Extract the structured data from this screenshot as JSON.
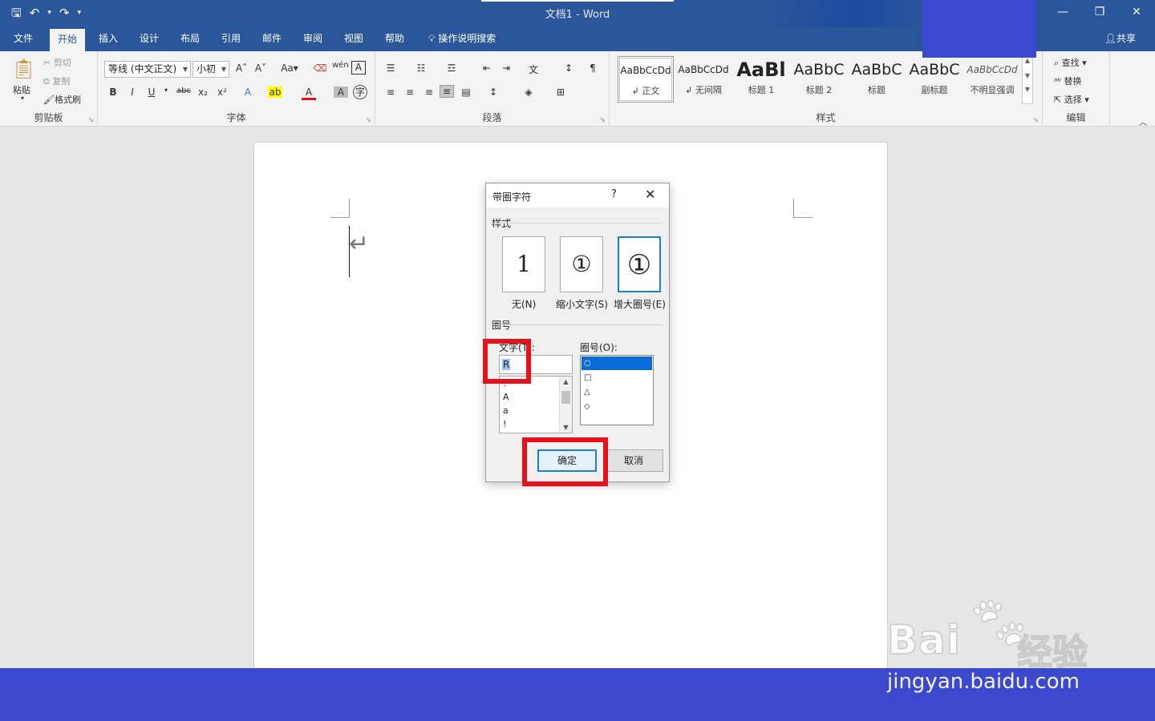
{
  "app": {
    "title": "文档1  -  Word"
  },
  "qat": {
    "save_icon": "save-icon",
    "undo_icon": "undo-icon",
    "redo_icon": "redo-icon",
    "customize_icon": "customize-qat-icon"
  },
  "window_controls": {
    "minimize": "—",
    "restore": "❐",
    "close": "✕"
  },
  "tabs": [
    {
      "label": "文件"
    },
    {
      "label": "开始"
    },
    {
      "label": "插入"
    },
    {
      "label": "设计"
    },
    {
      "label": "布局"
    },
    {
      "label": "引用"
    },
    {
      "label": "邮件"
    },
    {
      "label": "审阅"
    },
    {
      "label": "视图"
    },
    {
      "label": "帮助"
    }
  ],
  "tellme": {
    "label": "操作说明搜索"
  },
  "share": {
    "label": "共享"
  },
  "ribbon": {
    "clipboard": {
      "label": "剪贴板",
      "paste": "粘贴",
      "cut": "剪切",
      "copy": "复制",
      "format_painter": "格式刷"
    },
    "font": {
      "label": "字体",
      "font_name": "等线 (中文正文)",
      "font_size": "小初"
    },
    "paragraph": {
      "label": "段落"
    },
    "styles": {
      "label": "样式",
      "items": [
        {
          "preview": "AaBbCcDd",
          "name": "↲ 正文"
        },
        {
          "preview": "AaBbCcDd",
          "name": "↲ 无间隔"
        },
        {
          "preview": "AaBl",
          "name": "标题 1"
        },
        {
          "preview": "AaBbC",
          "name": "标题 2"
        },
        {
          "preview": "AaBbC",
          "name": "标题"
        },
        {
          "preview": "AaBbC",
          "name": "副标题"
        },
        {
          "preview": "AaBbCcDd",
          "name": "不明显强调"
        }
      ]
    },
    "editing": {
      "label": "编辑",
      "find": "查找",
      "replace": "替换",
      "select": "选择"
    }
  },
  "dialog": {
    "title": "带圈字符",
    "help": "?",
    "close": "✕",
    "style_section": "样式",
    "options": [
      {
        "glyph": "1",
        "label": "无(N)",
        "mnemonic": "N"
      },
      {
        "glyph": "①",
        "label": "缩小文字(S)",
        "mnemonic": "S"
      },
      {
        "glyph": "①",
        "label": "增大圈号(E)",
        "mnemonic": "E"
      }
    ],
    "enclosure_section": "圈号",
    "text_label": "文字(T):",
    "text_value": "R",
    "text_list": [
      "!",
      "A",
      "a",
      "!"
    ],
    "enclosure_label": "圈号(O):",
    "enclosure_items": [
      "○",
      "□",
      "△",
      "◇"
    ],
    "ok": "确定",
    "cancel": "取消"
  },
  "watermark": {
    "brand": "Bai",
    "cn": "经验",
    "url": "jingyan.baidu.com"
  },
  "colors": {
    "accent": "#2b579a",
    "highlight_red": "#e8101a",
    "band": "#3c48cd"
  }
}
